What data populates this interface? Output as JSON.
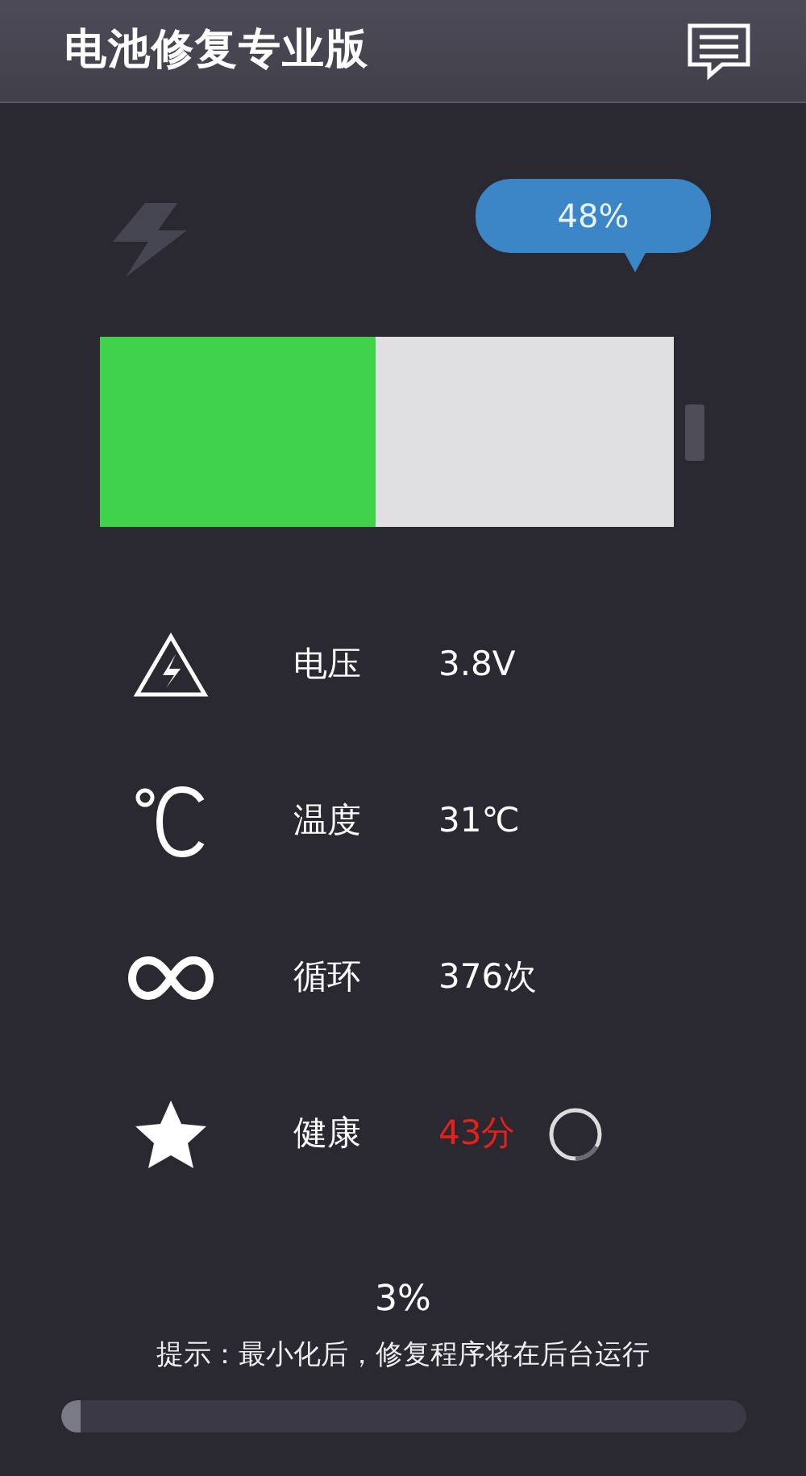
{
  "app_bar": {
    "title": "电池修复专业版"
  },
  "battery": {
    "charging": false,
    "level": 0.48,
    "percent": "48%"
  },
  "stats": [
    {
      "kind": "voltage",
      "label": "电压",
      "value": "3.8V",
      "alert": false
    },
    {
      "kind": "temperature",
      "label": "温度",
      "value": "31℃",
      "alert": false
    },
    {
      "kind": "cycle",
      "label": "循环",
      "value": "376次",
      "alert": false
    },
    {
      "kind": "health",
      "label": "健康",
      "value": "43分",
      "alert": true,
      "loading": true
    }
  ],
  "repair": {
    "percent": "3%",
    "hint": "提示：最小化后，修复程序将在后台运行",
    "level": 0.03
  }
}
